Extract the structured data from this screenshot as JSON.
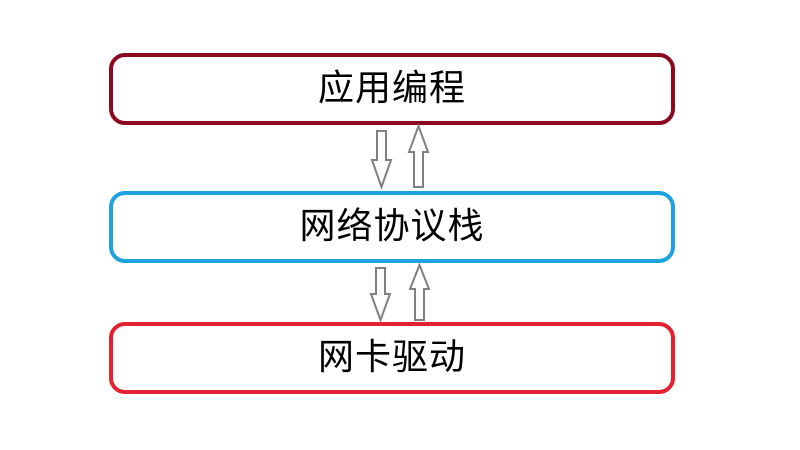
{
  "layers": [
    {
      "label": "应用编程",
      "border_color": "#8b0a1e"
    },
    {
      "label": "网络协议栈",
      "border_color": "#1ea3e0"
    },
    {
      "label": "网卡驱动",
      "border_color": "#e4212e"
    }
  ],
  "arrow_color": "#808080"
}
